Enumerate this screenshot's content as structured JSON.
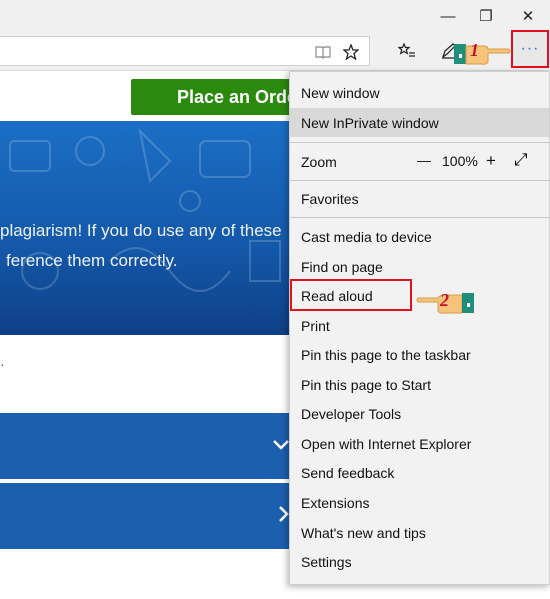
{
  "window": {
    "minimize_glyph": "—",
    "restore_glyph": "❐",
    "close_glyph": "✕"
  },
  "toolbar": {
    "reading_view_icon": "book-icon",
    "favorite_icon": "star-icon",
    "favorites_hub_icon": "favorites-list-icon",
    "notes_icon": "pen-icon",
    "more_label": "···"
  },
  "page": {
    "order_button": "Place an Orde",
    "hero_line1": "plagiarism! If you do use any of these",
    "hero_line2": "ference them correctly.",
    "side_mark": "·"
  },
  "menu": {
    "new_window": "New window",
    "new_inprivate": "New InPrivate window",
    "zoom_label": "Zoom",
    "zoom_out": "—",
    "zoom_value": "100%",
    "zoom_in": "+",
    "fullscreen_glyph": "⤢",
    "favorites": "Favorites",
    "cast": "Cast media to device",
    "find": "Find on page",
    "read_aloud": "Read aloud",
    "print": "Print",
    "pin_taskbar": "Pin this page to the taskbar",
    "pin_start": "Pin this page to Start",
    "dev_tools": "Developer Tools",
    "open_ie": "Open with Internet Explorer",
    "feedback": "Send feedback",
    "extensions": "Extensions",
    "whats_new": "What's new and tips",
    "settings": "Settings"
  },
  "annotations": {
    "step1": "1",
    "step2": "2",
    "highlight_color": "#e0121e"
  }
}
